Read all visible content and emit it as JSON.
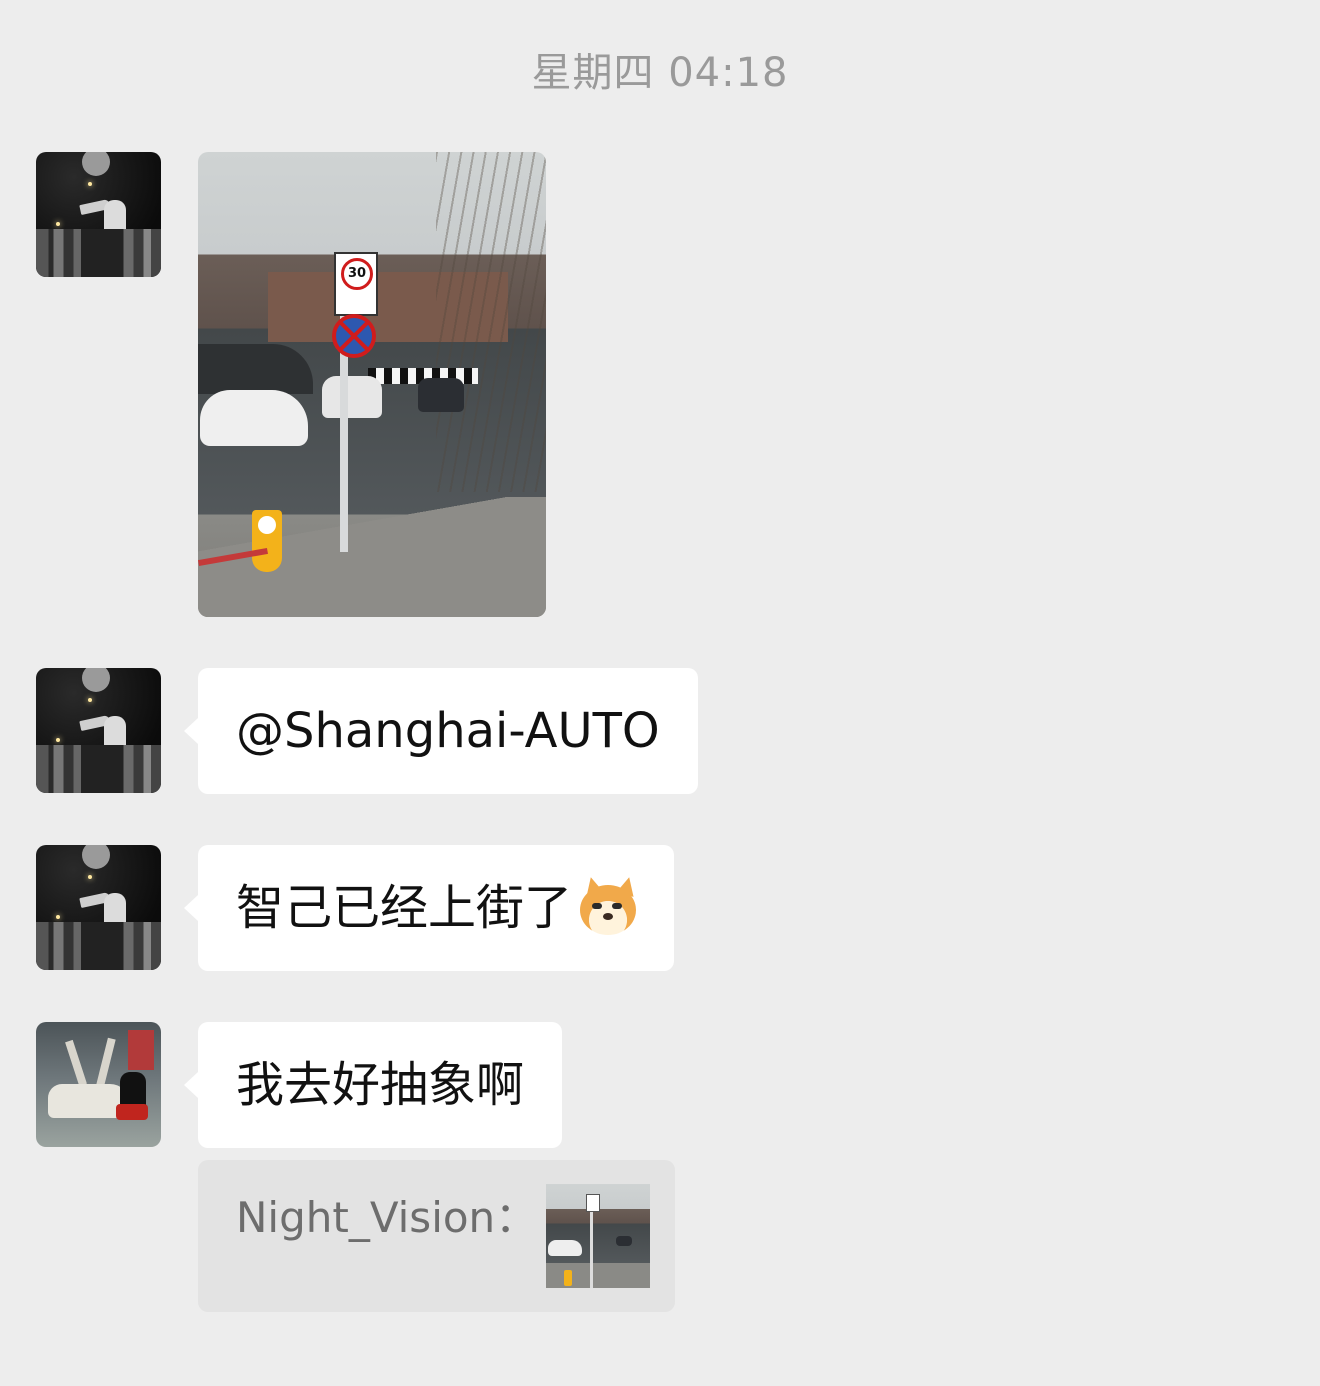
{
  "chat": {
    "timestamp": "星期四 04:18",
    "messages": [
      {
        "type": "image",
        "sender_avatar": "night-city-astronaut",
        "image_description_icon": "street-photo"
      },
      {
        "type": "text",
        "sender_avatar": "night-city-astronaut",
        "text": "@Shanghai-AUTO"
      },
      {
        "type": "text",
        "sender_avatar": "night-city-astronaut",
        "text": "智己已经上街了",
        "emoji": "doge-face-icon"
      },
      {
        "type": "text",
        "sender_avatar": "car-person",
        "text": "我去好抽象啊"
      }
    ],
    "quote": {
      "label": "Night_Vision：",
      "thumbnail": "street-photo-thumbnail"
    },
    "photo_sign_text": "30"
  }
}
